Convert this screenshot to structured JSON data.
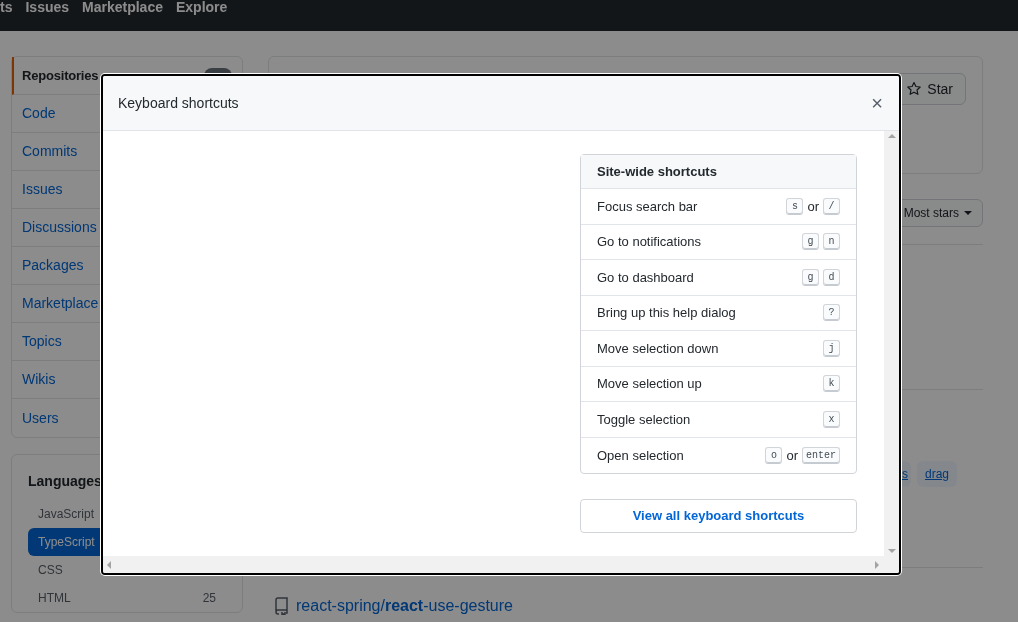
{
  "top_nav": {
    "items": [
      "ts",
      "Issues",
      "Marketplace",
      "Explore"
    ]
  },
  "sidebar": {
    "items": [
      {
        "label": "Repositories",
        "selected": true
      },
      {
        "label": "Code",
        "selected": false
      },
      {
        "label": "Commits",
        "selected": false
      },
      {
        "label": "Issues",
        "selected": false
      },
      {
        "label": "Discussions",
        "selected": false
      },
      {
        "label": "Packages",
        "selected": false
      },
      {
        "label": "Marketplace",
        "selected": false
      },
      {
        "label": "Topics",
        "selected": false
      },
      {
        "label": "Wikis",
        "selected": false
      },
      {
        "label": "Users",
        "selected": false
      }
    ]
  },
  "languages": {
    "title": "Languages",
    "items": [
      {
        "name": "JavaScript",
        "selected": false
      },
      {
        "name": "TypeScript",
        "selected": true
      },
      {
        "name": "CSS",
        "selected": false
      },
      {
        "name": "HTML",
        "count": "25",
        "selected": false
      }
    ]
  },
  "results": {
    "star_button": "Star",
    "sort_button": "Most stars",
    "tags": [
      "s",
      "drag"
    ],
    "repo": "react-spring/**react**-use-gesture"
  },
  "dialog": {
    "title": "Keyboard shortcuts",
    "close": "×",
    "section": {
      "title": "Site-wide shortcuts",
      "shortcuts": [
        {
          "label": "Focus search bar",
          "keys": [
            {
              "kind": "key",
              "text": "s"
            },
            {
              "kind": "sep",
              "text": "or"
            },
            {
              "kind": "key",
              "text": "/"
            }
          ]
        },
        {
          "label": "Go to notifications",
          "keys": [
            {
              "kind": "key",
              "text": "g"
            },
            {
              "kind": "key",
              "text": "n"
            }
          ]
        },
        {
          "label": "Go to dashboard",
          "keys": [
            {
              "kind": "key",
              "text": "g"
            },
            {
              "kind": "key",
              "text": "d"
            }
          ]
        },
        {
          "label": "Bring up this help dialog",
          "keys": [
            {
              "kind": "key",
              "text": "?"
            }
          ]
        },
        {
          "label": "Move selection down",
          "keys": [
            {
              "kind": "key",
              "text": "j"
            }
          ]
        },
        {
          "label": "Move selection up",
          "keys": [
            {
              "kind": "key",
              "text": "k"
            }
          ]
        },
        {
          "label": "Toggle selection",
          "keys": [
            {
              "kind": "key",
              "text": "x"
            }
          ]
        },
        {
          "label": "Open selection",
          "keys": [
            {
              "kind": "key",
              "text": "o"
            },
            {
              "kind": "sep",
              "text": "or"
            },
            {
              "kind": "key",
              "text": "enter"
            }
          ]
        }
      ]
    },
    "link_button": "View all keyboard shortcuts"
  }
}
